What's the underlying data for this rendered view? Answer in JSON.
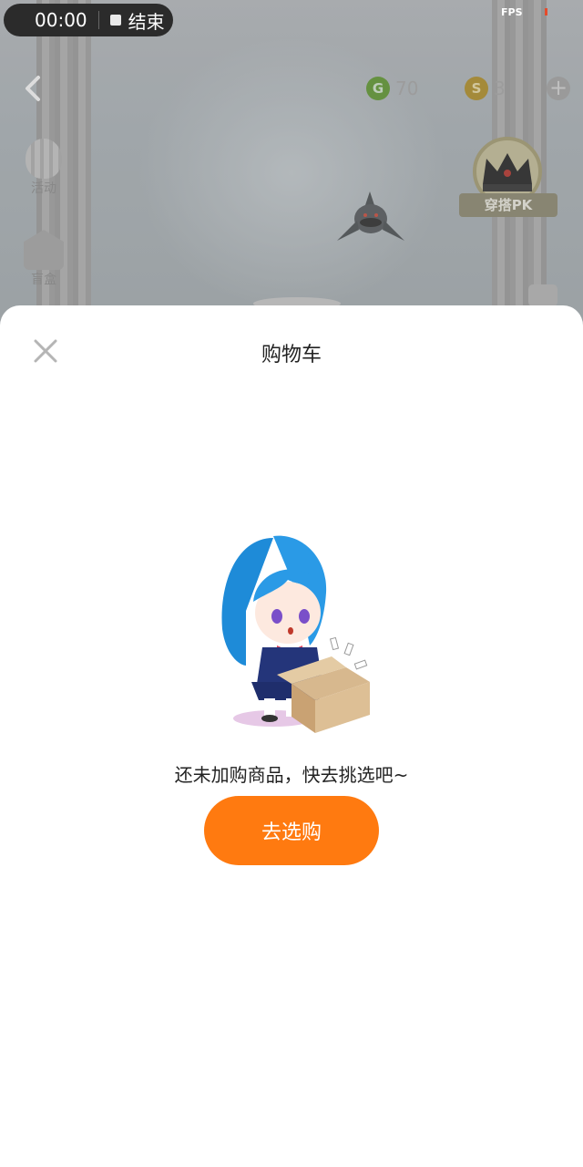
{
  "recording": {
    "time": "00:00",
    "stop_label": "结束"
  },
  "debug": {
    "fps_label": "FPS"
  },
  "topbar": {
    "green_coin_value": "70",
    "gold_coin_value": "3",
    "green_coin_glyph": "G",
    "gold_coin_glyph": "S"
  },
  "side_menu": {
    "activity_label": "活动",
    "blindbox_label": "盲盒"
  },
  "badge": {
    "pk_label": "穿搭PK"
  },
  "cart_sheet": {
    "title": "购物车",
    "empty_message": "还未加购商品，快去挑选吧~",
    "go_shopping_label": "去选购"
  },
  "colors": {
    "accent": "#ff7a10",
    "sheet_bg": "#ffffff"
  }
}
